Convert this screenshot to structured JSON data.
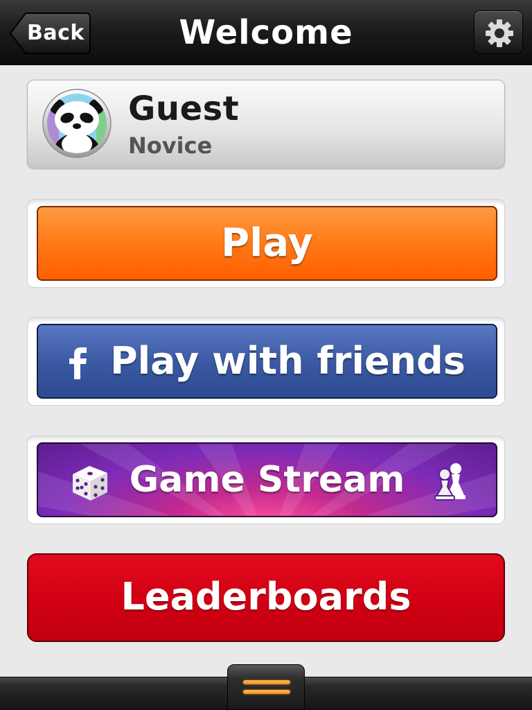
{
  "topbar": {
    "back_label": "Back",
    "title": "Welcome",
    "settings_icon": "gear-icon"
  },
  "profile": {
    "name": "Guest",
    "rank": "Novice",
    "avatar_icon": "panda-avatar"
  },
  "menu": {
    "play_label": "Play",
    "friends_label": "Play with friends",
    "friends_icon": "facebook-icon",
    "stream_label": "Game Stream",
    "stream_left_icon": "dice-icon",
    "stream_right_icon": "chess-pawns-icon",
    "leaderboards_label": "Leaderboards"
  },
  "bottom": {
    "drawer_icon": "drawer-handle-icon"
  },
  "colors": {
    "play": "#ff7a17",
    "friends": "#3b5aa3",
    "stream": "#7d2bb8",
    "leaderboards": "#d10014",
    "drawer_accent": "#f7a534"
  }
}
